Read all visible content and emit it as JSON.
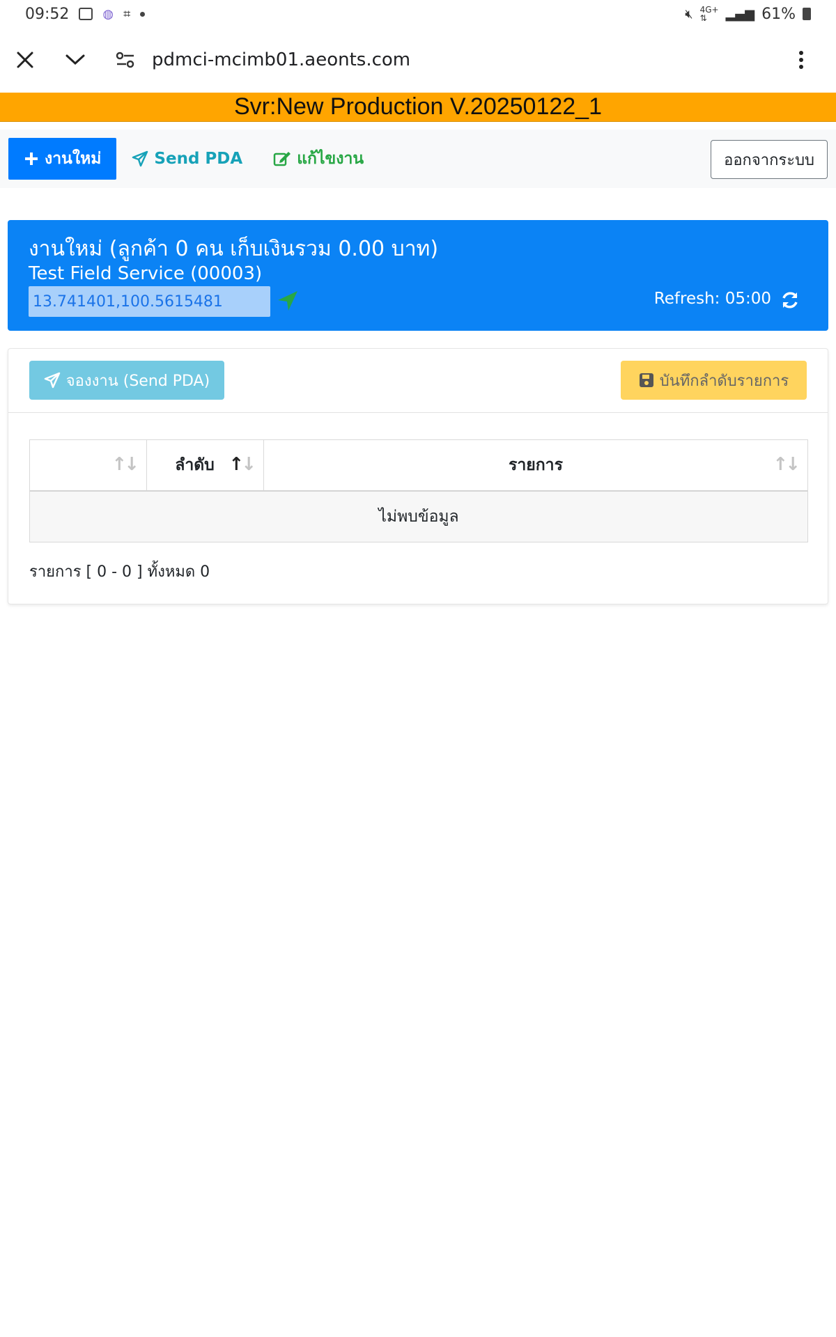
{
  "status_bar": {
    "time": "09:52",
    "battery": "61%"
  },
  "browser": {
    "url": "pdmci-mcimb01.aeonts.com"
  },
  "server_banner": "Svr:New Production V.20250122_1",
  "toolbar": {
    "new_job_label": "งานใหม่",
    "send_pda_label": "Send PDA",
    "edit_job_label": "แก้ไขงาน",
    "logout_label": "ออกจากระบบ"
  },
  "info_card": {
    "title": "งานใหม่ (ลูกค้า 0 คน เก็บเงินรวม 0.00 บาท)",
    "subtitle": "Test Field Service (00003)",
    "coordinates": "13.741401,100.5615481",
    "refresh": "Refresh: 05:00"
  },
  "card": {
    "reserve_label": "จองงาน (Send PDA)",
    "save_order_label": "บันทึกลำดับรายการ",
    "table": {
      "columns": [
        "",
        "ลำดับ",
        "รายการ"
      ],
      "empty_text": "ไม่พบข้อมูล"
    },
    "footer": "รายการ [ 0 - 0 ] ทั้งหมด 0"
  },
  "colors": {
    "banner": "#ffa500",
    "primary": "#007bff",
    "info": "#17a2b8",
    "success": "#28a745",
    "warning": "#ffd45e"
  }
}
